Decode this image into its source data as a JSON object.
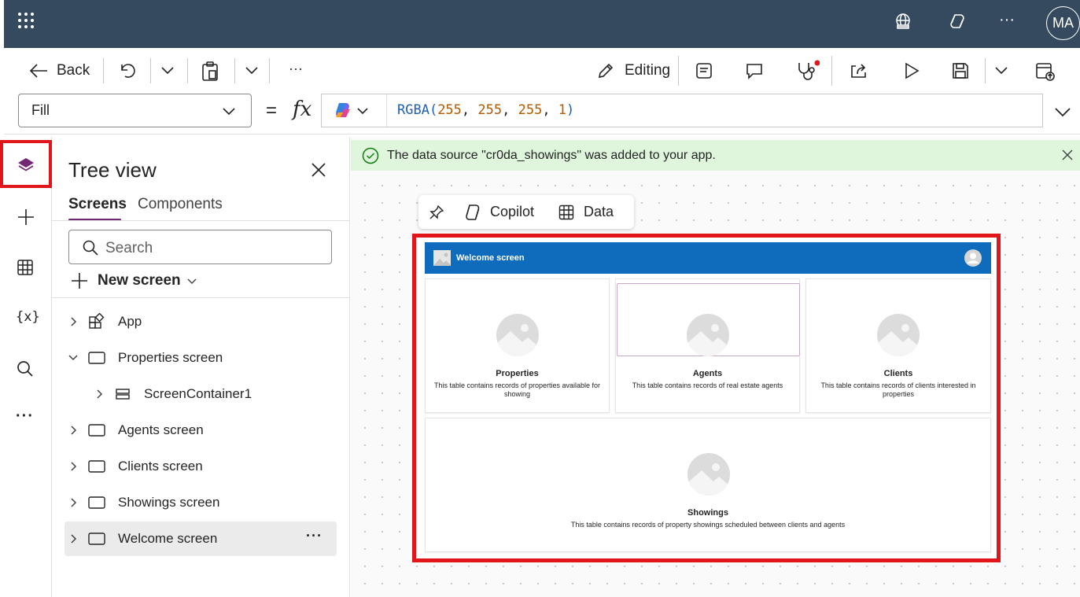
{
  "topbar": {
    "avatar_initials": "MA"
  },
  "commandbar": {
    "back_label": "Back",
    "editing_label": "Editing",
    "more_label": "···"
  },
  "formulabar": {
    "property": "Fill",
    "equals": "=",
    "fx": "fx",
    "formula_fn": "RGBA(",
    "formula_args": [
      "255",
      "255",
      "255",
      "1"
    ],
    "formula_close": ")"
  },
  "treeview": {
    "title": "Tree view",
    "tabs": [
      "Screens",
      "Components"
    ],
    "search_placeholder": "Search",
    "new_screen_label": "New screen",
    "items": [
      {
        "label": "App",
        "expanded": false,
        "indent": 0,
        "icon": "app-icon"
      },
      {
        "label": "Properties screen",
        "expanded": true,
        "indent": 0,
        "icon": "screen-icon"
      },
      {
        "label": "ScreenContainer1",
        "expanded": false,
        "indent": 1,
        "icon": "container-icon"
      },
      {
        "label": "Agents screen",
        "expanded": false,
        "indent": 0,
        "icon": "screen-icon"
      },
      {
        "label": "Clients screen",
        "expanded": false,
        "indent": 0,
        "icon": "screen-icon"
      },
      {
        "label": "Showings screen",
        "expanded": false,
        "indent": 0,
        "icon": "screen-icon"
      },
      {
        "label": "Welcome screen",
        "expanded": false,
        "indent": 0,
        "icon": "screen-icon",
        "selected": true,
        "more": "···"
      }
    ]
  },
  "canvas": {
    "banner_text": "The data source \"cr0da_showings\" was added to your app.",
    "toolbar": {
      "copilot_label": "Copilot",
      "data_label": "Data"
    },
    "app": {
      "header_title": "Welcome screen",
      "cards": [
        {
          "title": "Properties",
          "description": "This table contains records of properties available for showing"
        },
        {
          "title": "Agents",
          "description": "This table contains records of real estate agents"
        },
        {
          "title": "Clients",
          "description": "This table contains records of clients interested in properties"
        },
        {
          "title": "Showings",
          "description": "This table contains records of property showings scheduled between clients and agents"
        }
      ]
    }
  },
  "colors": {
    "topbar": "#354a5f",
    "accent": "#742774",
    "highlight": "#e0161b",
    "success_banner": "#dff6dd",
    "app_header": "#0f6cbd"
  }
}
